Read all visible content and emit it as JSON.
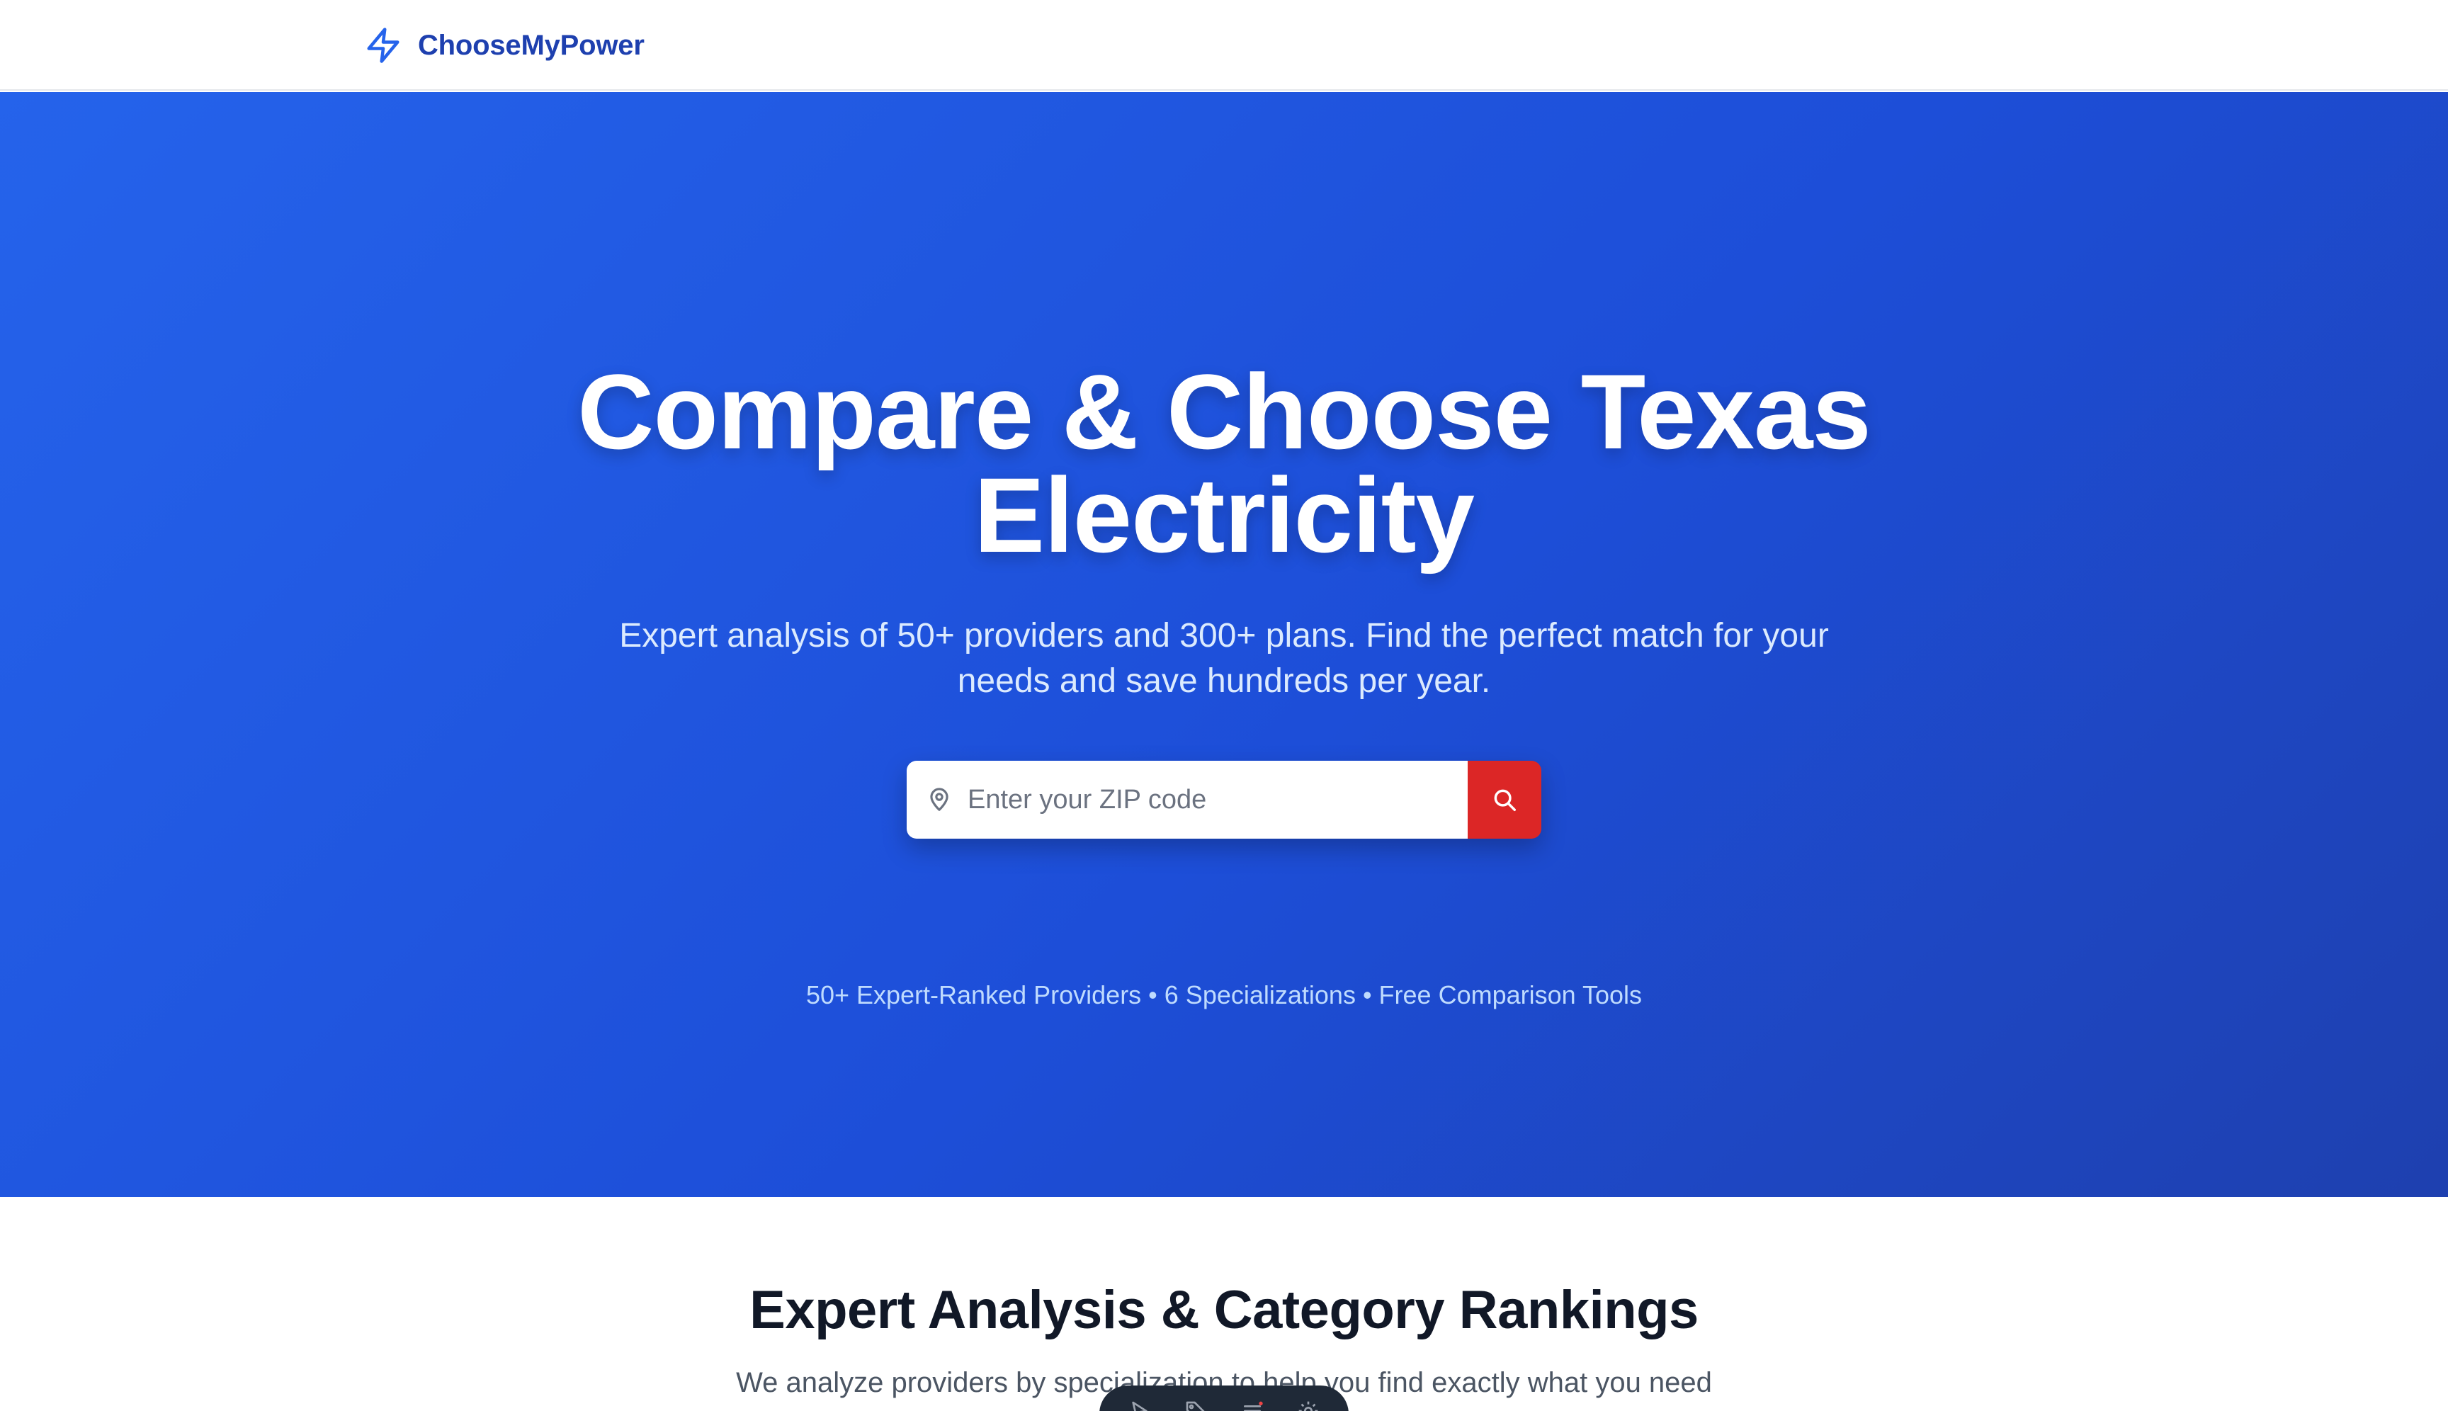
{
  "header": {
    "brand_name": "ChooseMyPower",
    "brand_icon": "lightning-bolt-icon"
  },
  "hero": {
    "title": "Compare & Choose Texas Electricity",
    "subtitle": "Expert analysis of 50+ providers and 300+ plans. Find the perfect match for your needs and save hundreds per year.",
    "search": {
      "placeholder": "Enter your ZIP code",
      "value": "",
      "field_icon": "map-pin-icon",
      "button_icon": "search-icon"
    },
    "stats": "50+ Expert-Ranked Providers • 6 Specializations • Free Comparison Tools"
  },
  "section": {
    "title": "Expert Analysis & Category Rankings",
    "subtitle": "We analyze providers by specialization to help you find exactly what you need"
  },
  "toolbar": {
    "icons": [
      "inspect-icon",
      "tag-icon",
      "menu-icon",
      "settings-icon"
    ]
  },
  "colors": {
    "brand": "#1e40af",
    "hero_start": "#2563eb",
    "hero_end": "#1e40af",
    "search_button": "#dc2626"
  }
}
